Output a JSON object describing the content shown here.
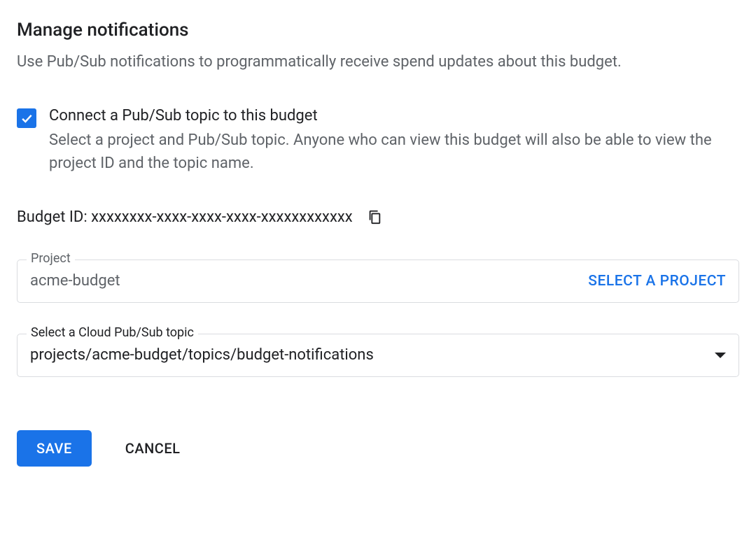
{
  "heading": "Manage notifications",
  "subheading": "Use Pub/Sub notifications to programmatically receive spend updates about this budget.",
  "checkbox": {
    "label": "Connect a Pub/Sub topic to this budget",
    "description": "Select a project and Pub/Sub topic. Anyone who can view this budget will also be able to view the project ID and the topic name.",
    "checked": true
  },
  "budget_id": {
    "label": "Budget ID: ",
    "value": "xxxxxxxx-xxxx-xxxx-xxxx-xxxxxxxxxxxx"
  },
  "project_field": {
    "label": "Project",
    "value": "acme-budget",
    "button": "SELECT A PROJECT"
  },
  "topic_field": {
    "label": "Select a Cloud Pub/Sub topic",
    "value": "projects/acme-budget/topics/budget-notifications"
  },
  "buttons": {
    "save": "SAVE",
    "cancel": "CANCEL"
  }
}
